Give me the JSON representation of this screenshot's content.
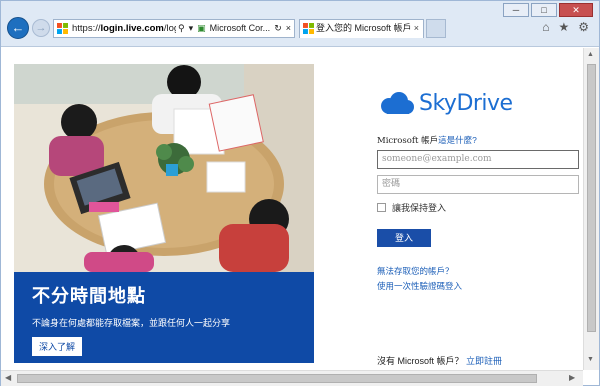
{
  "browser": {
    "address": {
      "prefix": "https://",
      "host": "login.live.com",
      "path": "/login.srf?wa="
    },
    "cert_label": "Microsoft Cor...",
    "tab": {
      "title": "登入您的 Microsoft 帳戶"
    },
    "icons": {
      "back": "back-arrow-icon",
      "forward": "forward-arrow-icon",
      "home": "home-icon",
      "favorites": "star-icon",
      "tools": "gear-icon"
    },
    "window_controls": {
      "minimize": "─",
      "maximize": "□",
      "close": "✕"
    }
  },
  "hero": {
    "title": "不分時間地點",
    "subtitle": "不論身在何處都能存取檔案，並跟任何人一起分享",
    "button": "深入了解",
    "panel_color": "#0f4aa6"
  },
  "login": {
    "brand": "SkyDrive",
    "brand_color": "#1c6ed2",
    "account_prefix": "Microsoft 帳戶",
    "account_link": "這是什麼?",
    "email_placeholder": "someone@example.com",
    "password_placeholder": "密碼",
    "remember_label": "讓我保持登入",
    "signin_button": "登入",
    "link_cant_access": "無法存取您的帳戶？",
    "link_one_time_code": "使用一次性驗證碼登入",
    "signup_prefix": "沒有 Microsoft 帳戶？",
    "signup_link": "立即註冊"
  }
}
